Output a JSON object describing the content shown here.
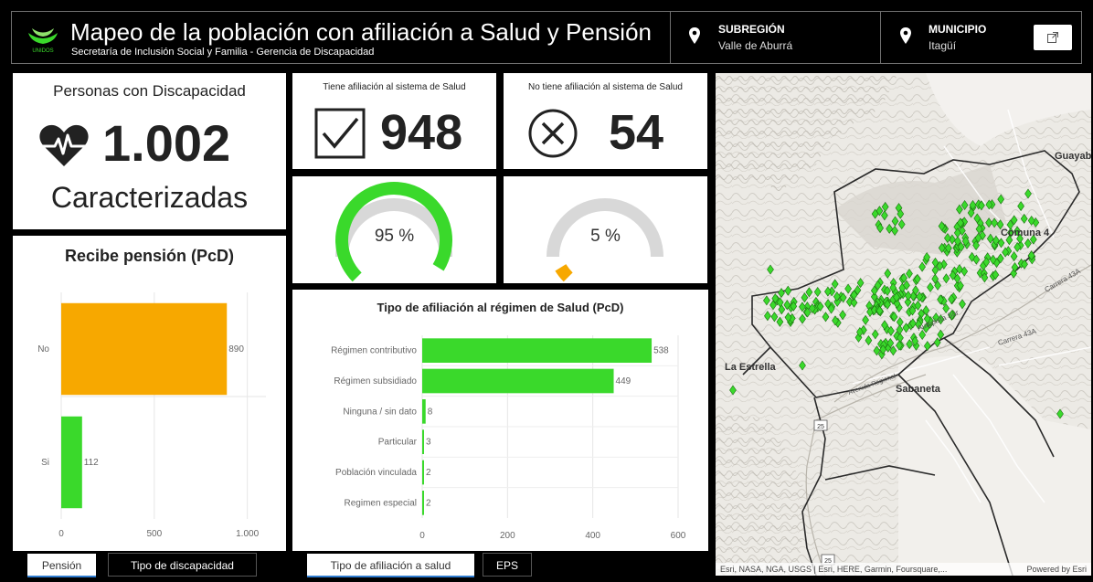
{
  "header": {
    "logo_text": "UNIDOS",
    "title": "Mapeo de la población con afiliación a Salud y Pensión",
    "subtitle": "Secretaría de Inclusión Social y Familia - Gerencia de Discapacidad",
    "filters": [
      {
        "label": "SUBREGIÓN",
        "value": "Valle de Aburrá"
      },
      {
        "label": "MUNICIPIO",
        "value": "Itagüí"
      }
    ],
    "open_external_icon": "external-link-icon"
  },
  "summary": {
    "title": "Personas con Discapacidad",
    "value": "1.002",
    "caption": "Caracterizadas",
    "icon": "heart-pulse-icon"
  },
  "kpis": {
    "with_health": {
      "label": "Tiene afiliación al sistema de Salud",
      "value": "948",
      "icon": "checkbox-checked-icon"
    },
    "without_health": {
      "label": "No tiene afiliación al sistema de Salud",
      "value": "54",
      "icon": "circle-x-icon"
    }
  },
  "gauges": {
    "with_health": {
      "text": "95 %",
      "fraction": 0.95,
      "color": "#3ad92b"
    },
    "without_health": {
      "text": "5 %",
      "fraction": 0.05,
      "color": "#f7a800"
    }
  },
  "pension_chart": {
    "title": "Recibe pensión (PcD)",
    "tick_labels": [
      "0",
      "500",
      "1.000"
    ]
  },
  "regime_chart": {
    "title": "Tipo de afiliación al régimen de Salud (PcD)",
    "tick_labels": [
      "0",
      "200",
      "400",
      "600"
    ]
  },
  "chart_data": [
    {
      "type": "bar",
      "orientation": "horizontal",
      "title": "Recibe pensión (PcD)",
      "categories": [
        "No",
        "Si"
      ],
      "values": [
        890,
        112
      ],
      "colors": [
        "#f7a800",
        "#3ad92b"
      ],
      "xlim": [
        0,
        1100
      ],
      "xticks": [
        0,
        500,
        1000
      ],
      "grid": true
    },
    {
      "type": "bar",
      "orientation": "horizontal",
      "title": "Tipo de afiliación al régimen de Salud (PcD)",
      "categories": [
        "Régimen contributivo",
        "Régimen subsidiado",
        "Ninguna / sin dato",
        "Particular",
        "Población vinculada",
        "Regimen especial"
      ],
      "values": [
        538,
        449,
        8,
        3,
        2,
        2
      ],
      "colors": [
        "#3ad92b"
      ],
      "xlim": [
        0,
        600
      ],
      "xticks": [
        0,
        200,
        400,
        600
      ],
      "grid": true
    }
  ],
  "tabs": {
    "left": [
      {
        "label": "Pensión",
        "active": true
      },
      {
        "label": "Tipo de discapacidad",
        "active": false
      }
    ],
    "middle": [
      {
        "label": "Tipo de afiliación a salud",
        "active": true
      },
      {
        "label": "EPS",
        "active": false
      }
    ]
  },
  "map": {
    "labels": [
      "Guayab",
      "Comuna 4",
      "La Estrella",
      "Sabaneta",
      "Autopista Sur",
      "Carrera 43A",
      "Carrera 43A",
      "Avenida Regional"
    ],
    "road_shields": [
      "25",
      "25"
    ],
    "attribution": "Esri, NASA, NGA, USGS | Esri, HERE, Garmin, Foursquare,...",
    "powered_by": "Powered by Esri",
    "marker_color": "#3ad92b"
  }
}
